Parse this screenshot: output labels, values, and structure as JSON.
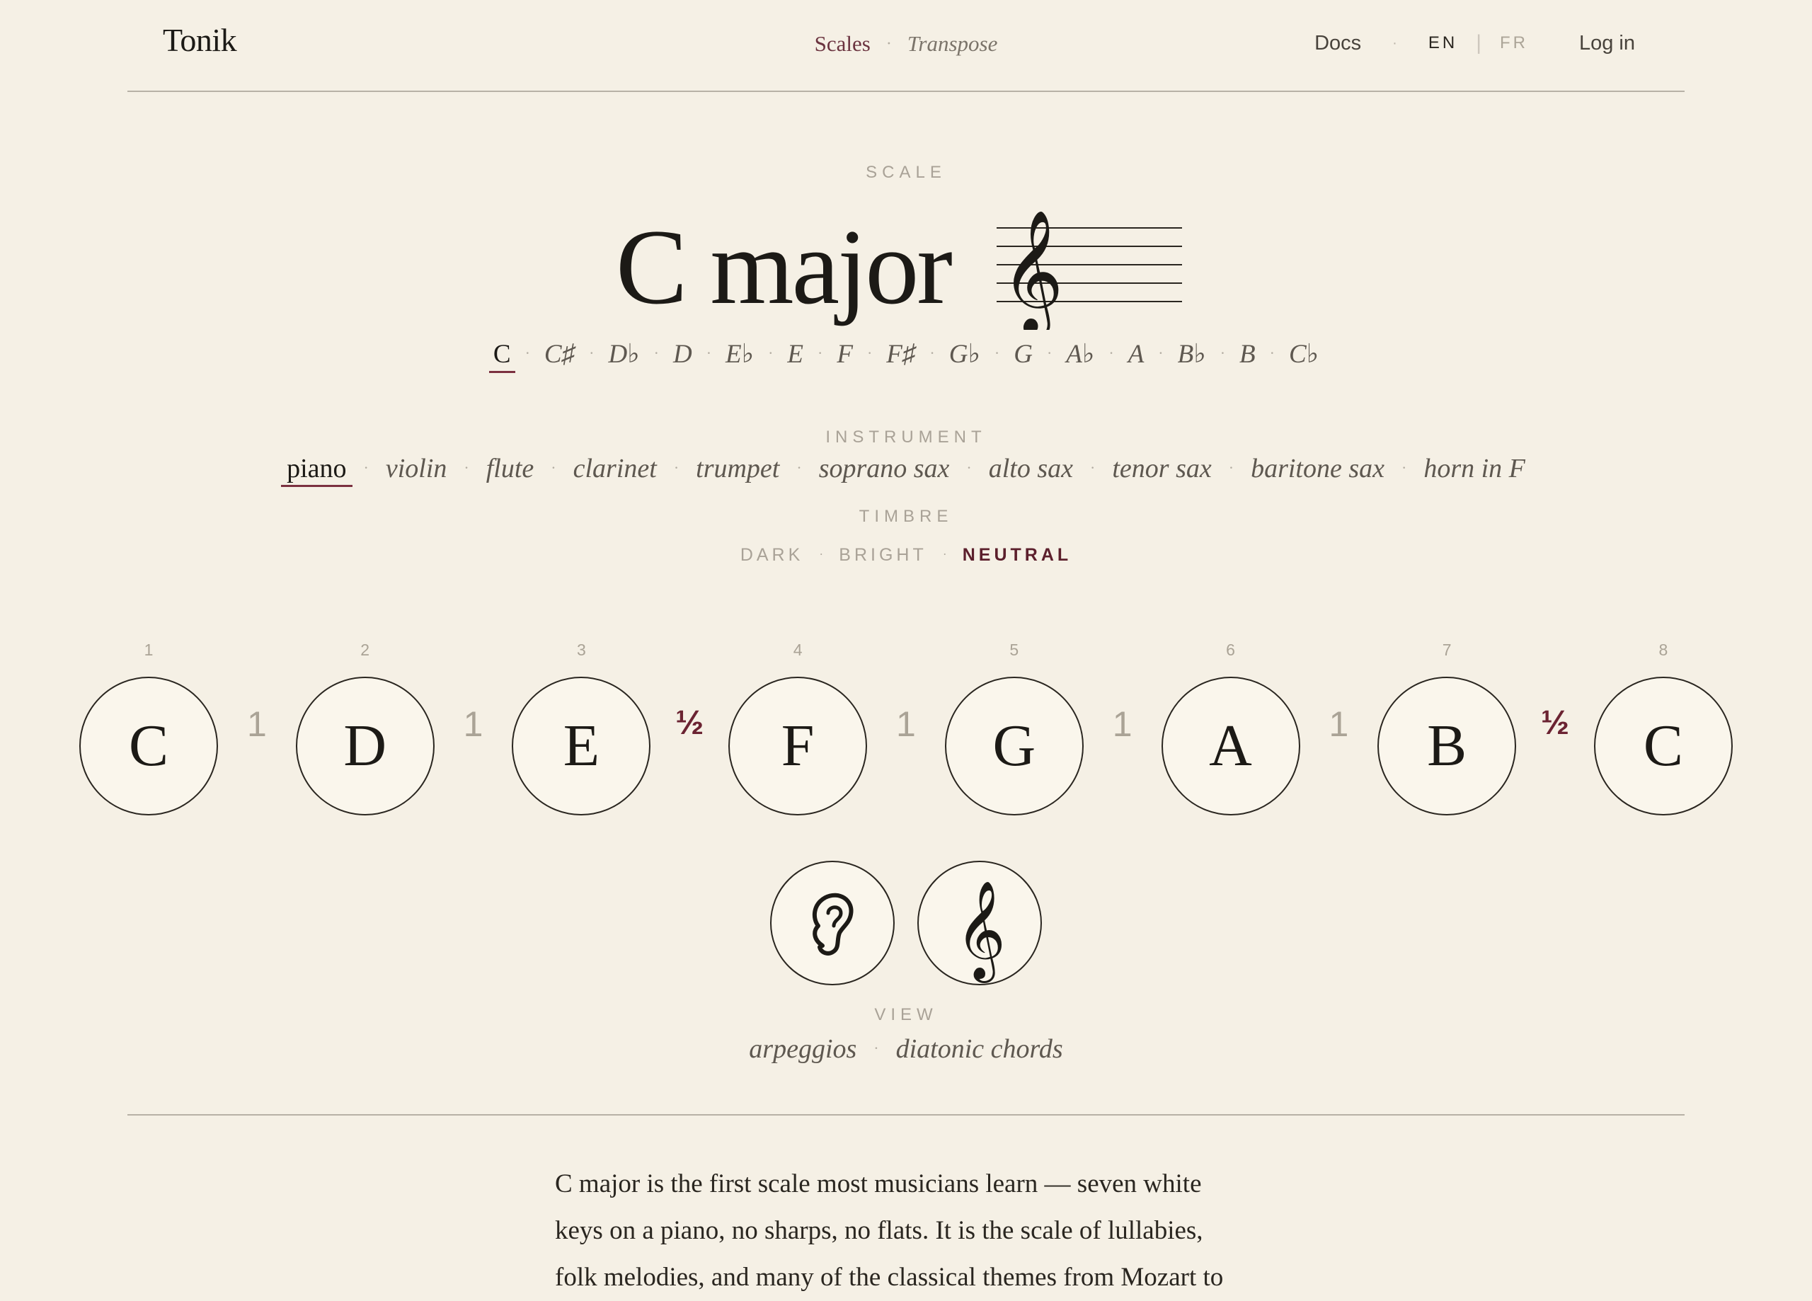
{
  "header": {
    "brand": "Tonik",
    "nav_scales": "Scales",
    "nav_sep": "·",
    "nav_transpose": "Transpose",
    "docs": "Docs",
    "lang_en": "EN",
    "lang_fr": "FR",
    "login": "Log in"
  },
  "scale": {
    "label": "SCALE",
    "title": "C major"
  },
  "keys": [
    "C",
    "C♯",
    "D♭",
    "D",
    "E♭",
    "E",
    "F",
    "F♯",
    "G♭",
    "G",
    "A♭",
    "A",
    "B♭",
    "B",
    "C♭"
  ],
  "selected_key": "C",
  "instrument": {
    "label": "INSTRUMENT",
    "options": [
      "piano",
      "violin",
      "flute",
      "clarinet",
      "trumpet",
      "soprano sax",
      "alto sax",
      "tenor sax",
      "baritone sax",
      "horn in F"
    ],
    "selected": "piano"
  },
  "timbre": {
    "label": "TIMBRE",
    "options": [
      "DARK",
      "BRIGHT",
      "NEUTRAL"
    ],
    "selected": "NEUTRAL"
  },
  "degrees": [
    "1",
    "2",
    "3",
    "4",
    "5",
    "6",
    "7",
    "8"
  ],
  "notes": [
    "C",
    "D",
    "E",
    "F",
    "G",
    "A",
    "B",
    "C"
  ],
  "steps": [
    "1",
    "1",
    "½",
    "1",
    "1",
    "1",
    "½"
  ],
  "buttons": {
    "listen_icon": "ear-icon",
    "notation_icon": "treble-clef-icon"
  },
  "view": {
    "label": "VIEW",
    "options": [
      "arpeggios",
      "diatonic chords"
    ]
  },
  "description": "C major is the first scale most musicians learn — seven white keys on a piano, no sharps, no flats. It is the scale of lullabies, folk melodies, and many of the classical themes from Mozart to",
  "colors": {
    "background": "#f5f0e5",
    "accent": "#6b2332",
    "ink": "#1c1a16",
    "muted": "#a9a297"
  }
}
